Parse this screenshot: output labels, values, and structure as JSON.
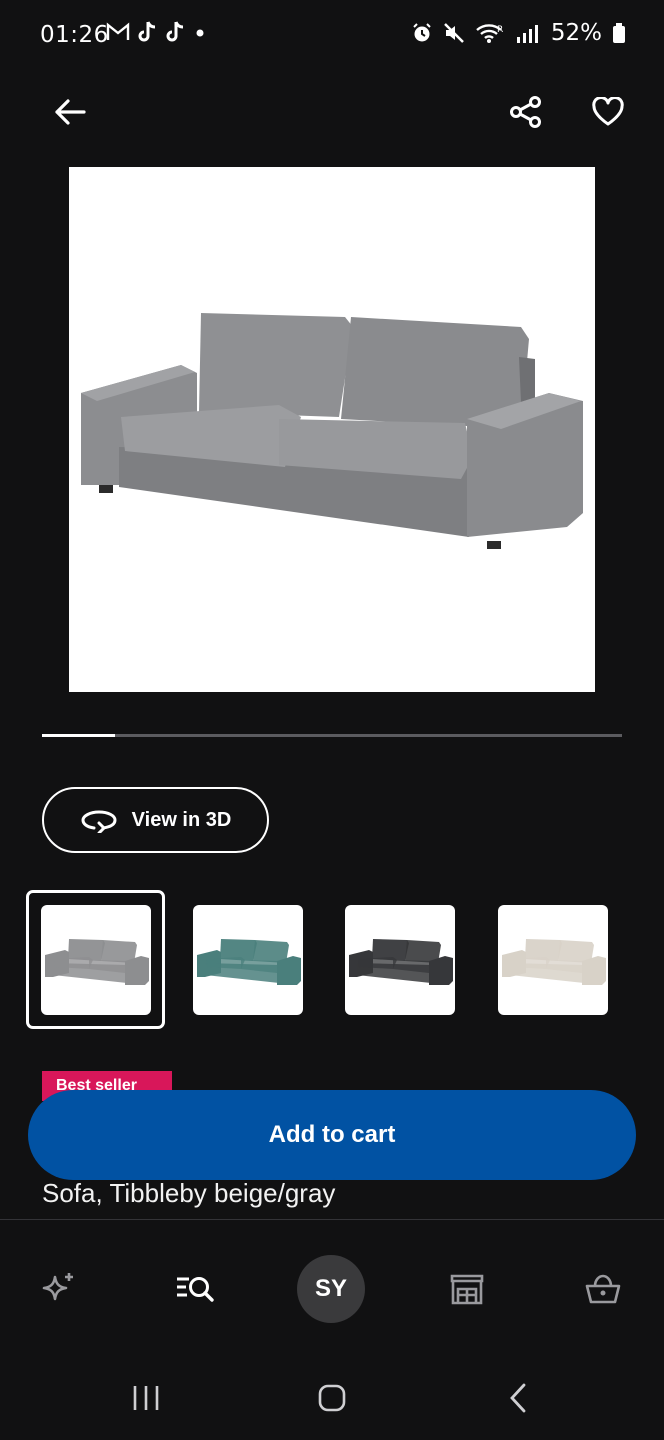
{
  "status_bar": {
    "time": "01:26",
    "notification_icons": [
      "gmail-icon",
      "tiktok-icon",
      "tiktok-icon",
      "dot-icon"
    ],
    "right_icons": [
      "alarm-icon",
      "mute-icon",
      "wifi-icon",
      "signal-r-icon",
      "signal-icon"
    ],
    "battery": "52%"
  },
  "top_bar": {
    "back_icon": "arrow-left-icon",
    "share_icon": "share-icon",
    "favorite_icon": "heart-icon"
  },
  "product": {
    "subtitle": "Sofa, Tibbleby beige/gray",
    "badge": "Best seller",
    "main_image_color": "#8e8f91",
    "carousel_progress_fraction": 0.125
  },
  "view_3d": {
    "label": "View in 3D",
    "icon": "rotate-3d-icon"
  },
  "variants": [
    {
      "name": "Tibbleby beige/gray",
      "color": "#8d8e90",
      "selected": true
    },
    {
      "name": "teal",
      "color": "#4a7f7c",
      "selected": false
    },
    {
      "name": "dark gray",
      "color": "#36373a",
      "selected": false
    },
    {
      "name": "beige",
      "color": "#d8d2c8",
      "selected": false
    }
  ],
  "cart": {
    "add_label": "Add to cart"
  },
  "bottom_nav": {
    "items": [
      {
        "id": "inspiration",
        "icon": "sparkle-icon"
      },
      {
        "id": "search",
        "icon": "search-list-icon"
      },
      {
        "id": "profile",
        "label": "SY"
      },
      {
        "id": "store",
        "icon": "store-icon"
      },
      {
        "id": "cart",
        "icon": "basket-icon"
      }
    ]
  },
  "colors": {
    "background": "#111112",
    "primary_button": "#0152a3",
    "badge": "#d8175a"
  }
}
